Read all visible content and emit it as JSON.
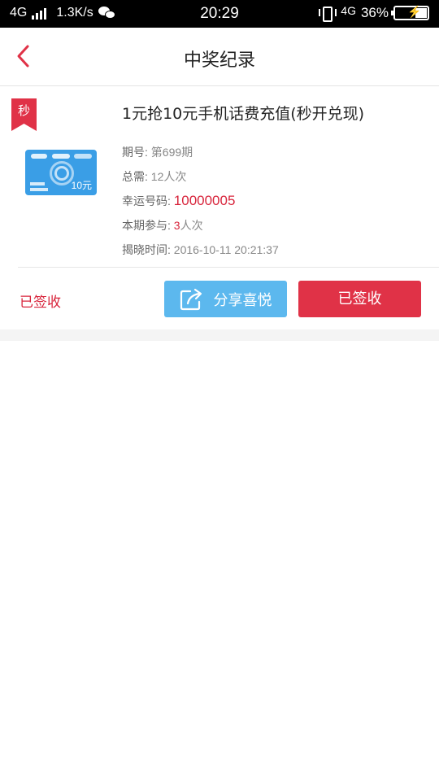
{
  "status_bar": {
    "network_type": "4G",
    "speed": "1.3K/s",
    "time": "20:29",
    "network_type_right": "4G",
    "battery": "36%"
  },
  "header": {
    "title": "中奖纪录",
    "back_icon": "chevron-left-icon"
  },
  "record": {
    "tag": "秒",
    "title": "1元抢10元手机话费充值(秒开兑现)",
    "thumbnail_denomination": "10元",
    "period_label": "期号:",
    "period_value": "第699期",
    "total_label": "总需:",
    "total_value": "12人次",
    "lucky_label": "幸运号码:",
    "lucky_value": "10000005",
    "joined_label": "本期参与:",
    "joined_count": "3",
    "joined_unit": "人次",
    "reveal_label": "揭晓时间:",
    "reveal_value": "2016-10-11 20:21:37",
    "status": "已签收",
    "share_button": "分享喜悦",
    "signed_button": "已签收"
  },
  "colors": {
    "accent_red": "#e03247",
    "share_blue": "#5cb8ee",
    "thumbnail_blue": "#3a9ee6"
  }
}
